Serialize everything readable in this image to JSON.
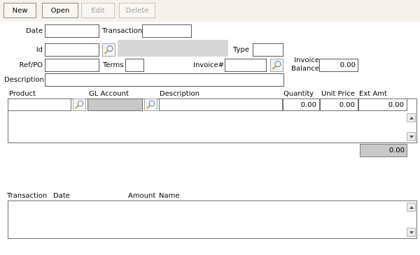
{
  "toolbar": {
    "new_label": "New",
    "open_label": "Open",
    "edit_label": "Edit",
    "delete_label": "Delete"
  },
  "form": {
    "date_label": "Date",
    "transaction_label": "Transaction",
    "id_label": "Id",
    "type_label": "Type",
    "refpo_label": "Ref/PO",
    "terms_label": "Terms",
    "invoice_num_label": "Invoice#",
    "invoice_balance_label_1": "Invoice",
    "invoice_balance_label_2": "Balance",
    "invoice_balance_value": "0.00",
    "description_label": "Description"
  },
  "lines": {
    "headers": {
      "product": "Product",
      "gl_account": "GL Account",
      "description": "Description",
      "quantity": "Quantity",
      "unit_price": "Unit Price",
      "ext_amt": "Ext Amt"
    },
    "row": {
      "quantity": "0.00",
      "unit_price": "0.00",
      "ext_amt": "0.00"
    },
    "total": "0.00"
  },
  "history": {
    "headers": {
      "transaction": "Transaction",
      "date": "Date",
      "amount": "Amount",
      "name": "Name"
    }
  },
  "icons": {
    "lookup": "magnifier-icon",
    "scroll_up": "arrow-up-icon",
    "scroll_down": "arrow-down-icon"
  },
  "colors": {
    "toolbar_bg": "#f4f2ea",
    "readonly_field": "#d6d6d6"
  }
}
